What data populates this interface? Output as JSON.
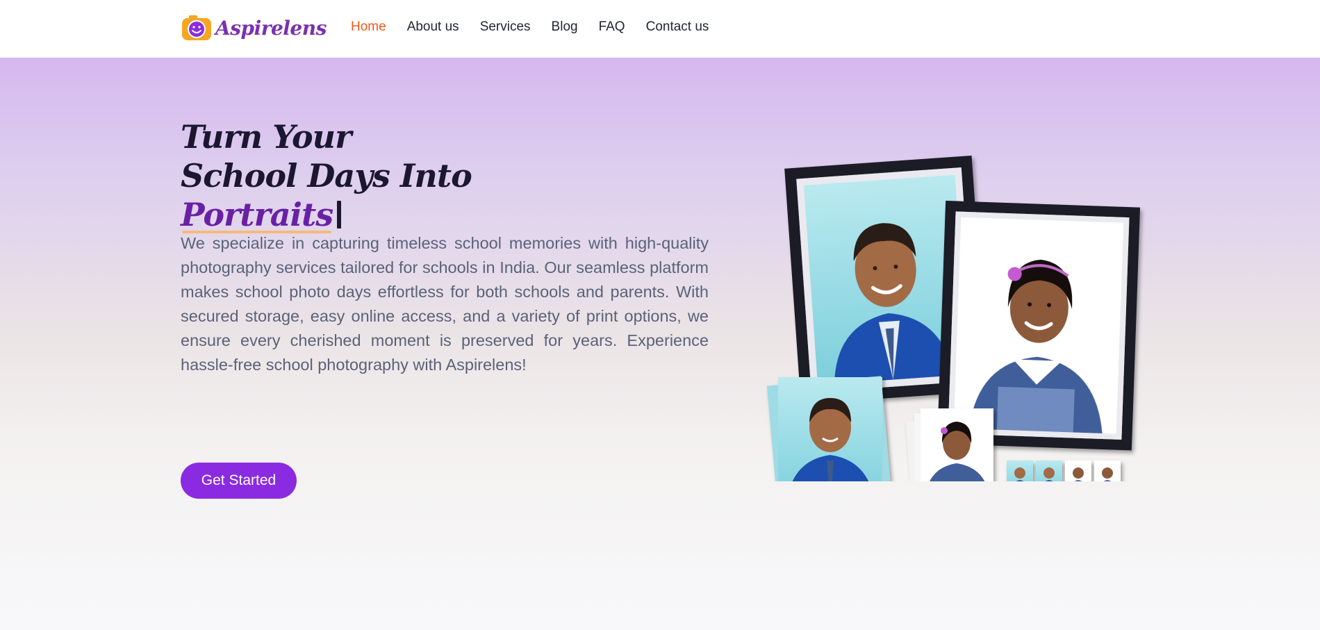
{
  "brand": {
    "name": "Aspirelens",
    "logo_icon": "smiling-camera-icon",
    "colors": {
      "primary": "#8a2be2",
      "accent": "#f05a1a",
      "logo_orange": "#f5a623"
    }
  },
  "nav": {
    "items": [
      {
        "label": "Home",
        "active": true
      },
      {
        "label": "About us",
        "active": false
      },
      {
        "label": "Services",
        "active": false
      },
      {
        "label": "Blog",
        "active": false
      },
      {
        "label": "FAQ",
        "active": false
      },
      {
        "label": "Contact us",
        "active": false
      }
    ]
  },
  "hero": {
    "headline_line1": "Turn Your",
    "headline_line2": "School Days Into",
    "headline_highlight": "Portraits",
    "description": "We specialize in capturing timeless school memories with high-quality photography services tailored for schools in India. Our seamless platform makes school photo days effortless for both schools and parents. With secured storage, easy online access, and a variety of print options, we ensure every cherished moment is preserved for years. Experience hassle-free school photography with Aspirelens!",
    "cta_label": "Get Started",
    "illustration": "school-portrait-prints-collage"
  }
}
